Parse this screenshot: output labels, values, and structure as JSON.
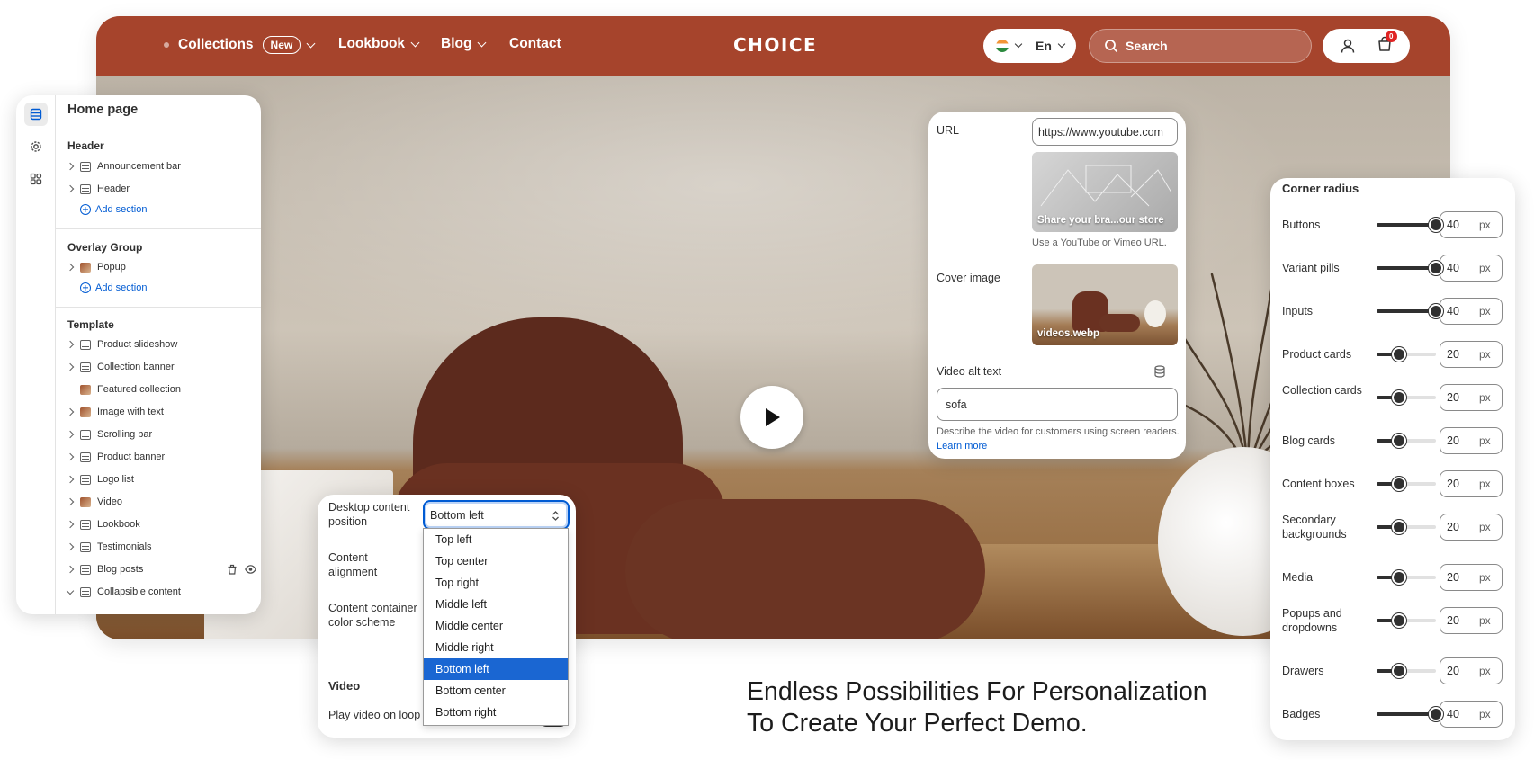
{
  "store": {
    "nav": {
      "collections": "Collections",
      "new_badge": "New",
      "lookbook": "Lookbook",
      "blog": "Blog",
      "contact": "Contact"
    },
    "logo": "CHOICE",
    "language": "En",
    "search_label": "Search",
    "cart_count": "0"
  },
  "sidebar": {
    "title": "Home page",
    "header_group": {
      "title": "Header",
      "items": [
        "Announcement bar",
        "Header"
      ],
      "add_section": "Add section"
    },
    "overlay_group": {
      "title": "Overlay Group",
      "items": [
        "Popup"
      ],
      "add_section": "Add section"
    },
    "template_group": {
      "title": "Template",
      "items": [
        "Product slideshow",
        "Collection banner",
        "Featured collection",
        "Image with text",
        "Scrolling bar",
        "Product banner",
        "Logo list",
        "Video",
        "Lookbook",
        "Testimonials",
        "Blog posts",
        "Collapsible content"
      ]
    }
  },
  "video_panel": {
    "url_label": "URL",
    "url_value": "https://www.youtube.com",
    "thumb_caption": "Share your bra...our store",
    "url_help": "Use a YouTube or Vimeo URL.",
    "cover_label": "Cover image",
    "cover_caption": "videos.webp",
    "alt_label": "Video alt text",
    "alt_value": "sofa",
    "alt_help": "Describe the video for customers using screen readers.",
    "learn_more": "Learn more"
  },
  "radius_panel": {
    "title": "Corner radius",
    "unit": "px",
    "max": 40,
    "rows": [
      {
        "label": "Buttons",
        "value": 40
      },
      {
        "label": "Variant pills",
        "value": 40
      },
      {
        "label": "Inputs",
        "value": 40
      },
      {
        "label": "Product cards",
        "value": 20
      },
      {
        "label": "Collection cards",
        "value": 20
      },
      {
        "label": "Blog cards",
        "value": 20
      },
      {
        "label": "Content boxes",
        "value": 20
      },
      {
        "label": "Secondary backgrounds",
        "value": 20
      },
      {
        "label": "Media",
        "value": 20
      },
      {
        "label": "Popups and dropdowns",
        "value": 20
      },
      {
        "label": "Drawers",
        "value": 20
      },
      {
        "label": "Badges",
        "value": 40
      }
    ]
  },
  "position_panel": {
    "desktop_position_label": "Desktop content position",
    "selected_value": "Bottom left",
    "content_alignment_label": "Content alignment",
    "color_scheme_label": "Content container color scheme",
    "video_section_title": "Video",
    "play_loop_label": "Play video on loop",
    "options": [
      "Top left",
      "Top center",
      "Top right",
      "Middle left",
      "Middle center",
      "Middle right",
      "Bottom left",
      "Bottom center",
      "Bottom right"
    ],
    "selected_index": 6
  },
  "tagline": {
    "line1": "Endless Possibilities For Personalization",
    "line2": "To Create Your Perfect Demo."
  },
  "colors": {
    "brand": "#a6442c",
    "accent_blue": "#005bd3",
    "selected_option": "#1a66d2"
  }
}
